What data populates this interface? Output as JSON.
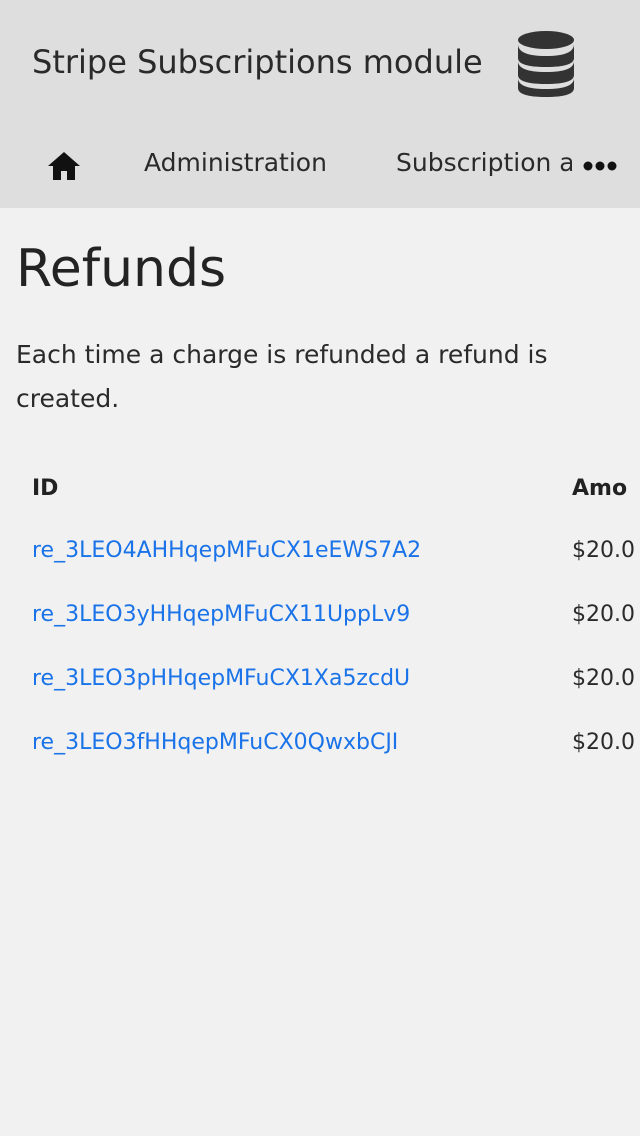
{
  "header": {
    "app_title": "Stripe Subscriptions module",
    "app_icon": "database-icon"
  },
  "nav": {
    "home_icon": "home-icon",
    "items": [
      {
        "label": "Administration"
      },
      {
        "label": "Subscription a"
      }
    ],
    "more_icon": "more-horizontal-icon"
  },
  "main": {
    "title": "Refunds",
    "description": "Each time a charge is refunded a refund is created."
  },
  "table": {
    "columns": [
      {
        "label": "ID"
      },
      {
        "label": "Amo"
      }
    ],
    "rows": [
      {
        "id": "re_3LEO4AHHqepMFuCX1eEWS7A2",
        "amount": "$20.0"
      },
      {
        "id": "re_3LEO3yHHqepMFuCX11UppLv9",
        "amount": "$20.0"
      },
      {
        "id": "re_3LEO3pHHqepMFuCX1Xa5zcdU",
        "amount": "$20.0"
      },
      {
        "id": "re_3LEO3fHHqepMFuCX0QwxbCJI",
        "amount": "$20.0"
      }
    ]
  },
  "colors": {
    "header_bg": "#dedede",
    "page_bg": "#f1f1f1",
    "link": "#1a73e8",
    "icon": "#333333"
  }
}
